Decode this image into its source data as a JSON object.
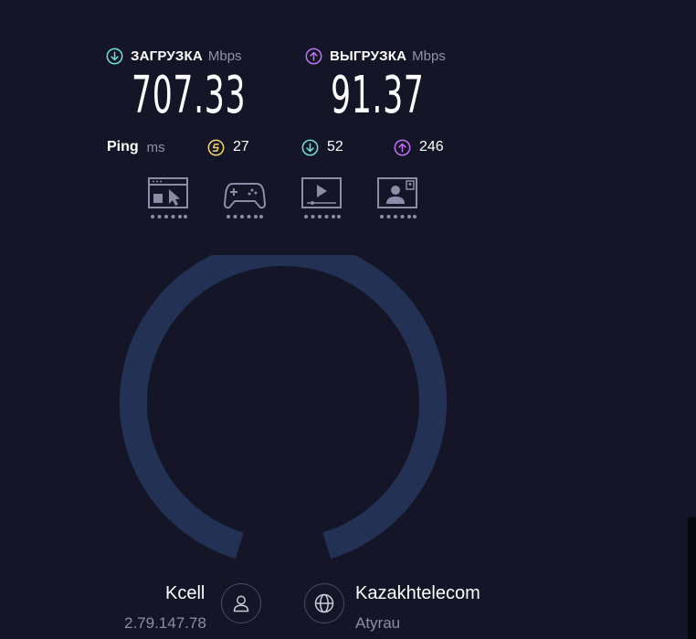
{
  "download": {
    "label": "ЗАГРУЗКА",
    "unit": "Mbps",
    "value": "707.33",
    "icon": "arrow-down-circle-icon",
    "color": "#6de0d6"
  },
  "upload": {
    "label": "ВЫГРУЗКА",
    "unit": "Mbps",
    "value": "91.37",
    "icon": "arrow-up-circle-icon",
    "color": "#bf71f5"
  },
  "ping": {
    "label": "Ping",
    "unit": "ms",
    "idle": {
      "value": "27",
      "icon": "jitter-circle-icon",
      "color": "#f5d56b"
    },
    "down": {
      "value": "52",
      "icon": "arrow-down-circle-icon",
      "color": "#6de0d6"
    },
    "up": {
      "value": "246",
      "icon": "arrow-up-circle-icon",
      "color": "#bf71f5"
    }
  },
  "ratings": [
    {
      "name": "web-browsing-icon",
      "dots": 5
    },
    {
      "name": "gaming-icon",
      "dots": 5
    },
    {
      "name": "video-streaming-icon",
      "dots": 5
    },
    {
      "name": "video-chat-icon",
      "dots": 5
    }
  ],
  "gauge": {
    "track_color": "#233254"
  },
  "client": {
    "name": "Kcell",
    "ip": "2.79.147.78",
    "icon": "user-icon"
  },
  "server": {
    "name": "Kazakhtelecom",
    "location": "Atyrau",
    "icon": "globe-icon"
  }
}
